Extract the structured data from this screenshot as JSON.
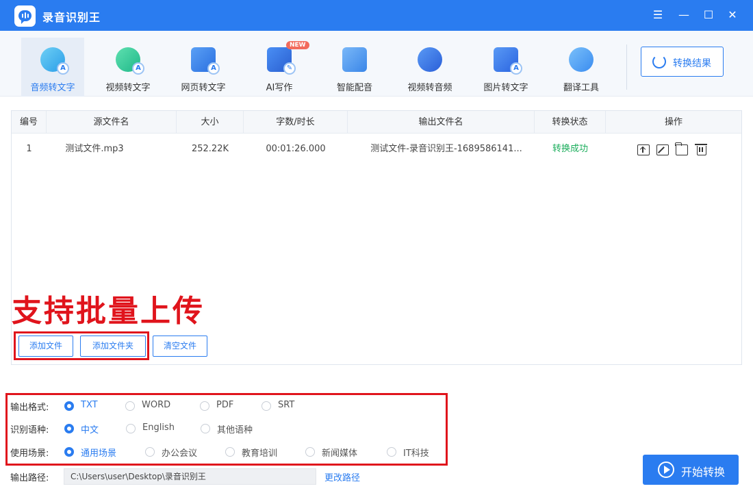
{
  "app": {
    "title": "录音识别王"
  },
  "window_controls": {
    "menu": "☰",
    "minimize": "—",
    "maximize": "☐",
    "close": "✕"
  },
  "toolbar": {
    "tools": [
      {
        "label": "音频转文字",
        "icon": "audio-to-text-icon",
        "active": true
      },
      {
        "label": "视频转文字",
        "icon": "video-to-text-icon"
      },
      {
        "label": "网页转文字",
        "icon": "webpage-to-text-icon"
      },
      {
        "label": "AI写作",
        "icon": "ai-writing-icon",
        "badge": "NEW"
      },
      {
        "label": "智能配音",
        "icon": "smart-dubbing-icon"
      },
      {
        "label": "视频转音频",
        "icon": "video-to-audio-icon"
      },
      {
        "label": "图片转文字",
        "icon": "image-to-text-icon"
      },
      {
        "label": "翻译工具",
        "icon": "translate-icon"
      }
    ],
    "result_button": "转换结果"
  },
  "table": {
    "headers": [
      "编号",
      "源文件名",
      "大小",
      "字数/时长",
      "输出文件名",
      "转换状态",
      "操作"
    ],
    "rows": [
      {
        "index": "1",
        "source": "测试文件.mp3",
        "size": "252.22K",
        "duration": "00:01:26.000",
        "output": "测试文件-录音识别王-1689586141...",
        "status": "转换成功"
      }
    ]
  },
  "annotation": {
    "batch_text": "支持批量上传"
  },
  "file_buttons": {
    "add_file": "添加文件",
    "add_folder": "添加文件夹",
    "clear": "清空文件"
  },
  "options": {
    "format": {
      "label": "输出格式:",
      "choices": [
        "TXT",
        "WORD",
        "PDF",
        "SRT"
      ],
      "selected": "TXT"
    },
    "language": {
      "label": "识别语种:",
      "choices": [
        "中文",
        "English",
        "其他语种"
      ],
      "selected": "中文"
    },
    "scene": {
      "label": "使用场景:",
      "choices": [
        "通用场景",
        "办公会议",
        "教育培训",
        "新闻媒体",
        "IT科技"
      ],
      "selected": "通用场景"
    }
  },
  "output_path": {
    "label": "输出路径:",
    "value": "C:\\Users\\user\\Desktop\\录音识别王",
    "change": "更改路径"
  },
  "start_button": "开始转换",
  "colors": {
    "accent": "#2a7cf0",
    "success": "#1aad5b",
    "annotation_red": "#e0141c"
  }
}
